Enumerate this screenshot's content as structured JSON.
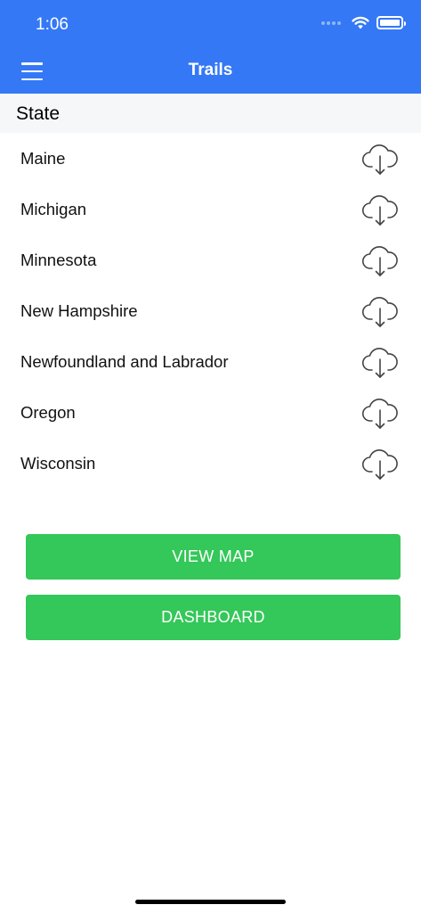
{
  "status_bar": {
    "time": "1:06",
    "icons": [
      "cellular-signal-icon",
      "wifi-icon",
      "battery-icon"
    ]
  },
  "nav": {
    "menu_icon": "hamburger-menu-icon",
    "title": "Trails"
  },
  "section": {
    "header": "State"
  },
  "states": [
    {
      "name": "Maine",
      "icon": "cloud-download-icon"
    },
    {
      "name": "Michigan",
      "icon": "cloud-download-icon"
    },
    {
      "name": "Minnesota",
      "icon": "cloud-download-icon"
    },
    {
      "name": "New Hampshire",
      "icon": "cloud-download-icon"
    },
    {
      "name": "Newfoundland and Labrador",
      "icon": "cloud-download-icon"
    },
    {
      "name": "Oregon",
      "icon": "cloud-download-icon"
    },
    {
      "name": "Wisconsin",
      "icon": "cloud-download-icon"
    }
  ],
  "buttons": {
    "view_map": "VIEW MAP",
    "dashboard": "DASHBOARD"
  },
  "colors": {
    "header_bg": "#3478f6",
    "button_bg": "#34c759",
    "section_bg": "#f6f7f8"
  }
}
